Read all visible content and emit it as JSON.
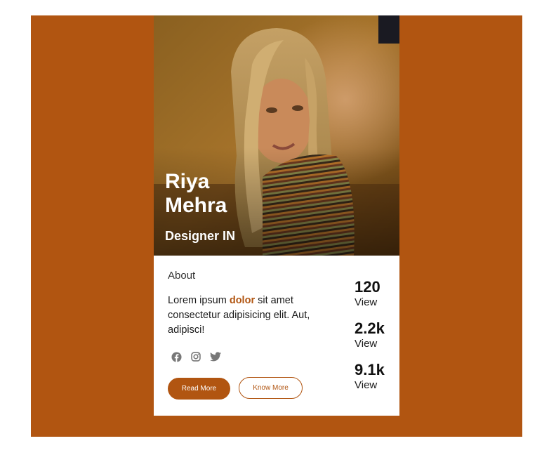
{
  "profile": {
    "first_name": "Riya",
    "last_name": "Mehra",
    "role": "Designer IN"
  },
  "about": {
    "title": "About",
    "text_before": "Lorem ipsum ",
    "text_highlight": "dolor",
    "text_after": " sit amet consectetur adipisicing elit. Aut, adipisci!"
  },
  "socials": [
    {
      "icon": "facebook-icon"
    },
    {
      "icon": "instagram-icon"
    },
    {
      "icon": "twitter-icon"
    }
  ],
  "buttons": {
    "read_more": "Read More",
    "know_more": "Know More"
  },
  "stats": [
    {
      "value": "120",
      "label": "View"
    },
    {
      "value": "2.2k",
      "label": "View"
    },
    {
      "value": "9.1k",
      "label": "View"
    }
  ],
  "colors": {
    "accent": "#b15511",
    "background": "#ffffff",
    "icon_gray": "#777777"
  }
}
